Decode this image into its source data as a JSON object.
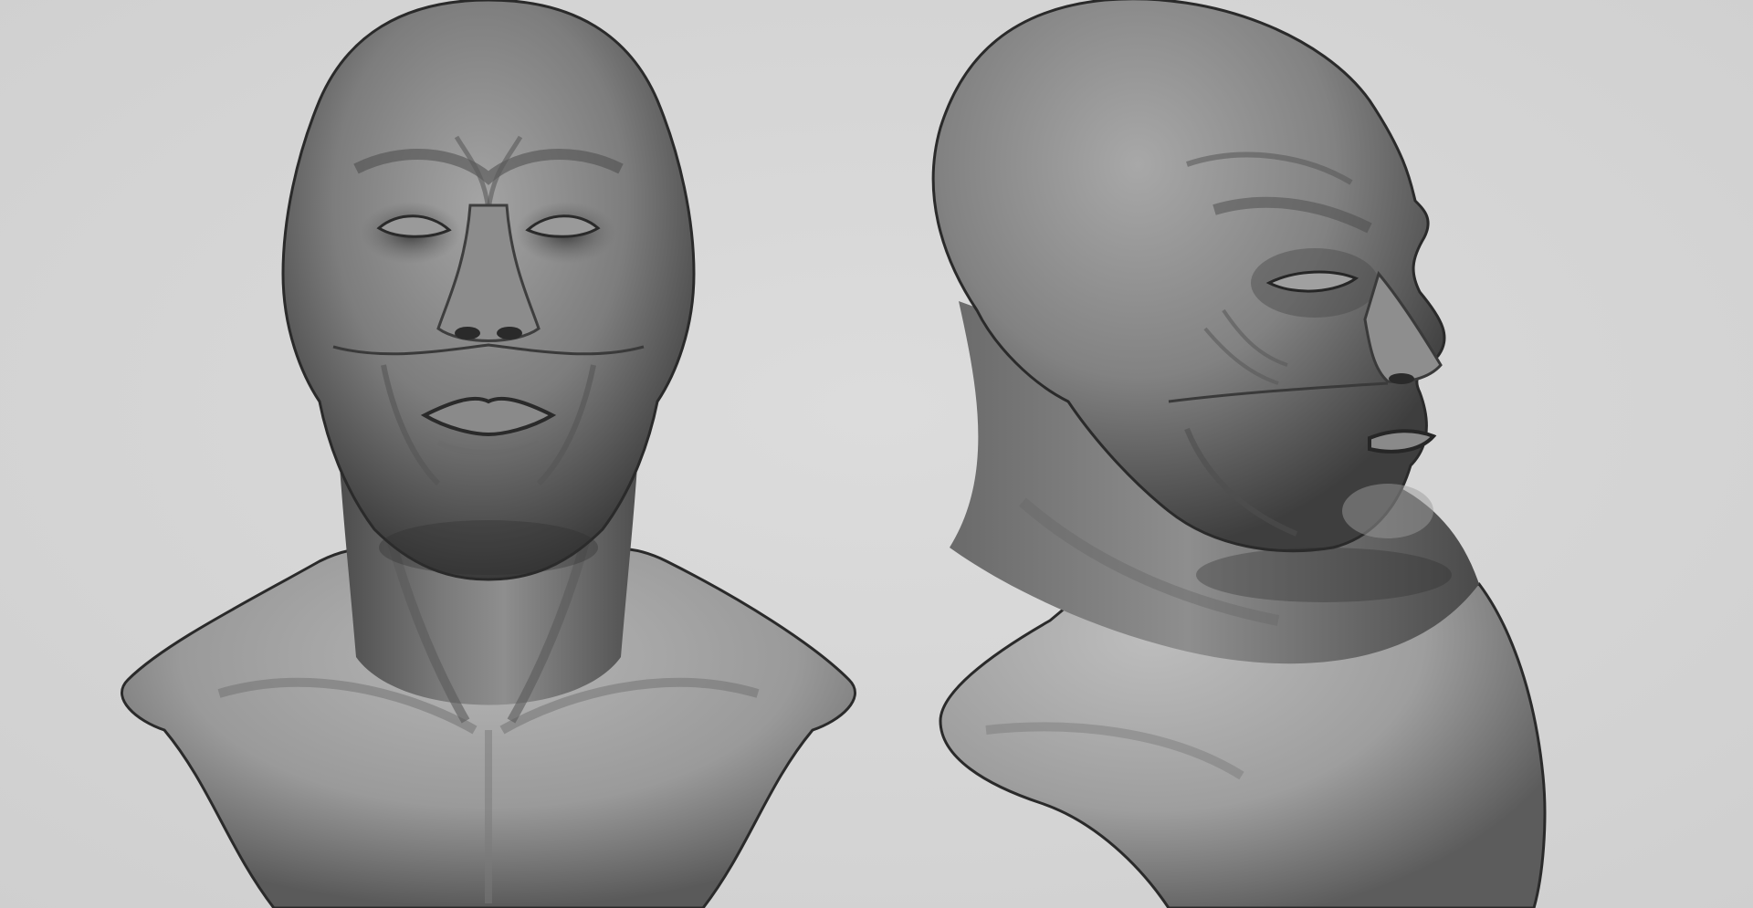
{
  "scene": {
    "background_color": "#d6d6d6",
    "material_color": "#7c7c7c",
    "shadow_color": "#1e1e1e",
    "highlight_color": "#b8b8b8"
  },
  "render": {
    "views": [
      "front",
      "three-quarter"
    ]
  }
}
